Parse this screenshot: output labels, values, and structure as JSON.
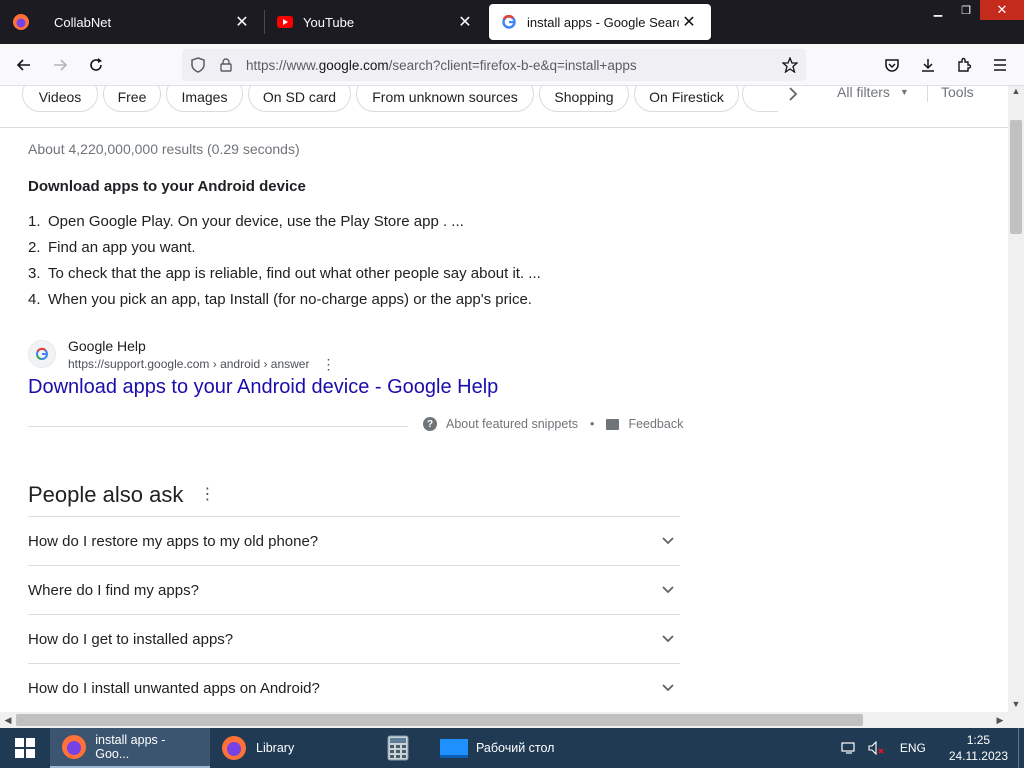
{
  "browser": {
    "tabs": [
      {
        "title": "CollabNet",
        "favicon": "firefox-icon",
        "active": false
      },
      {
        "title": "YouTube",
        "favicon": "youtube-icon",
        "active": false
      },
      {
        "title": "install apps - Google Search",
        "favicon": "google-g-icon",
        "active": true
      }
    ],
    "url_prefix": "https://www.",
    "url_domain": "google.com",
    "url_path": "/search?client=firefox-b-e&q=install+apps"
  },
  "chips": [
    "Videos",
    "Free",
    "Images",
    "On SD card",
    "From unknown sources",
    "Shopping",
    "On Firestick"
  ],
  "filters": {
    "all_filters": "All filters",
    "tools": "Tools"
  },
  "results_stats": "About 4,220,000,000 results (0.29 seconds)",
  "snippet": {
    "heading": "Download apps to your Android device",
    "steps": [
      {
        "num": "1.",
        "text": "Open Google Play. On your device, use the Play Store app . ..."
      },
      {
        "num": "2.",
        "text": "Find an app you want."
      },
      {
        "num": "3.",
        "text": "To check that the app is reliable, find out what other people say about it. ..."
      },
      {
        "num": "4.",
        "text": "When you pick an app, tap Install (for no-charge apps) or the app's price."
      }
    ],
    "source_name": "Google Help",
    "source_url": "https://support.google.com › android › answer",
    "link_title": "Download apps to your Android device - Google Help",
    "about_label": "About featured snippets",
    "separator": "•",
    "feedback_label": "Feedback"
  },
  "people_also_ask": {
    "title": "People also ask",
    "questions": [
      "How do I restore my apps to my old phone?",
      "Where do I find my apps?",
      "How do I get to installed apps?",
      "How do I install unwanted apps on Android?"
    ]
  },
  "taskbar": {
    "items": [
      {
        "label": "install apps - Goo...",
        "icon": "firefox-icon",
        "active": true
      },
      {
        "label": "Library",
        "icon": "firefox-icon",
        "active": false
      },
      {
        "label": "",
        "icon": "calculator-icon",
        "active": false
      },
      {
        "label": "Рабочий стол",
        "icon": "desktop-icon",
        "active": false
      }
    ],
    "language": "ENG",
    "time": "1:25",
    "date": "24.11.2023"
  },
  "colors": {
    "link": "#1a0dab",
    "taskbar": "#1f3a52",
    "tabstrip": "#1c1b22"
  }
}
